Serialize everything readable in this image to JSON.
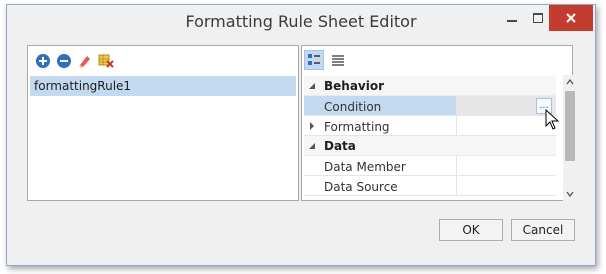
{
  "window": {
    "title": "Formatting Rule Sheet Editor"
  },
  "window_controls": {
    "minimize_icon": "minimize-icon",
    "maximize_icon": "maximize-icon",
    "close_icon": "close-icon"
  },
  "left_toolbar": [
    "add-rule-icon",
    "remove-rule-icon",
    "clear-rules-icon",
    "purge-rules-icon"
  ],
  "rules_list": {
    "items": [
      {
        "label": "formattingRule1",
        "selected": true
      }
    ]
  },
  "property_grid": {
    "toolbar": [
      "categorized-icon",
      "alphabetical-icon"
    ],
    "rows": [
      {
        "type": "category",
        "label": "Behavior",
        "expanded": true
      },
      {
        "type": "property",
        "label": "Condition",
        "value": "",
        "selected": true,
        "has_ellipsis": true,
        "ellipsis_label": "..."
      },
      {
        "type": "property",
        "label": "Formatting",
        "value": "",
        "expandable": true
      },
      {
        "type": "category",
        "label": "Data",
        "expanded": true
      },
      {
        "type": "property",
        "label": "Data Member",
        "value": ""
      },
      {
        "type": "property",
        "label": "Data Source",
        "value": ""
      }
    ]
  },
  "buttons": {
    "ok": "OK",
    "cancel": "Cancel"
  },
  "colors": {
    "selection": "#c3d9f0",
    "close_button": "#c43c2f",
    "window_bg": "#f0f0f0",
    "panel_border": "#a9a9a9"
  }
}
